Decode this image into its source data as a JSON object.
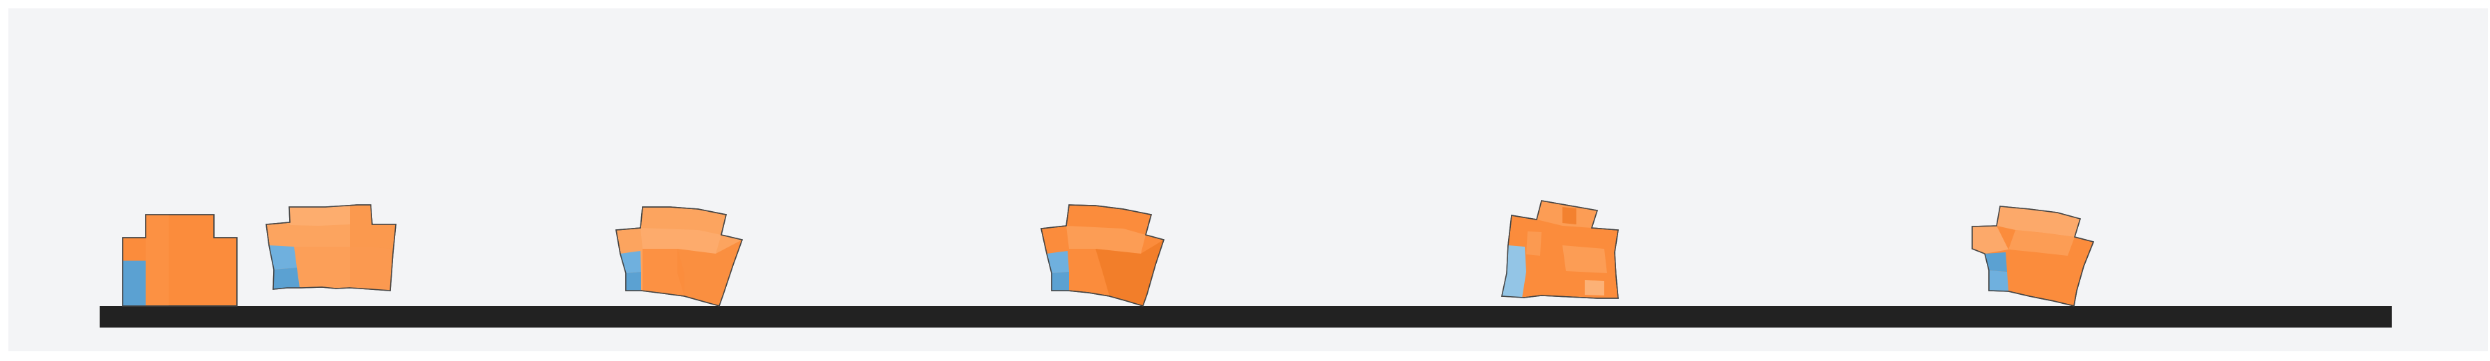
{
  "scene": {
    "background_color": "#f3f4f6",
    "ground_color": "#222222",
    "object_count": 6,
    "colors": {
      "orange_dark": "#f07a25",
      "orange": "#fb8c3c",
      "orange_light": "#fca45f",
      "orange_pale": "#fdba84",
      "blue": "#5ba1d2",
      "blue_light": "#93c5e6",
      "outline": "#444444"
    }
  }
}
